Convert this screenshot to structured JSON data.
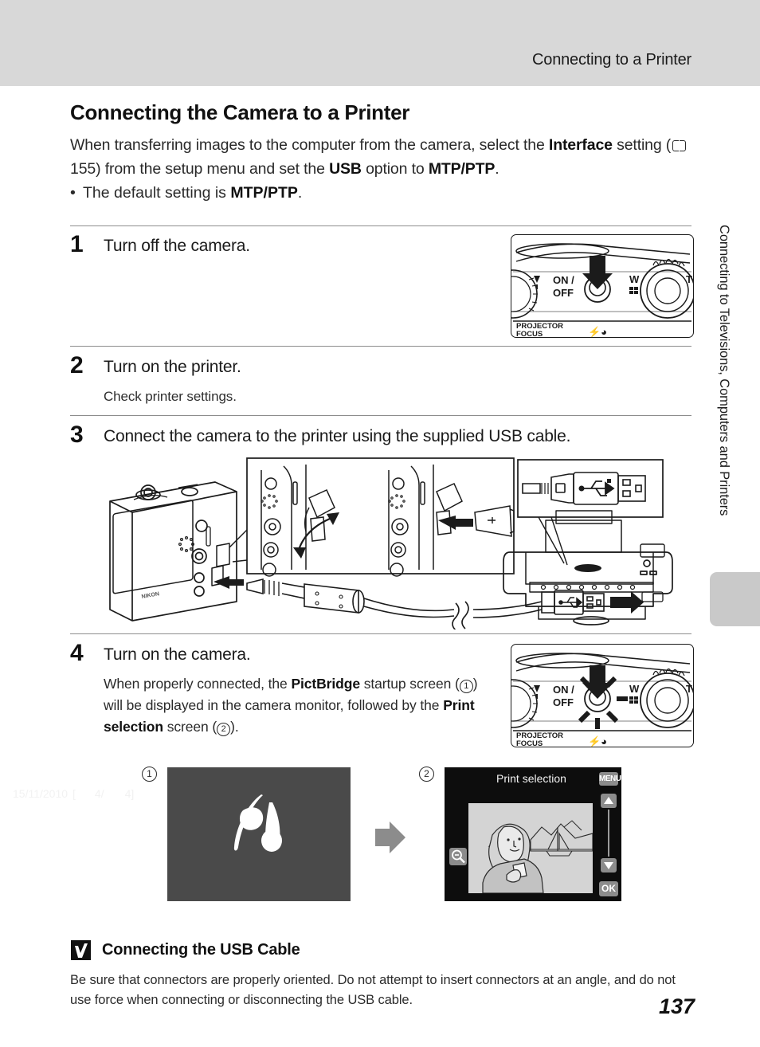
{
  "header": {
    "running_title": "Connecting to a Printer"
  },
  "side_tab": {
    "text": "Connecting to Televisions, Computers and Printers"
  },
  "section": {
    "heading": "Connecting the Camera to a Printer",
    "intro_part1": "When transferring images to the computer from the camera, select the ",
    "intro_bold1": "Interface",
    "intro_part2": " setting (",
    "intro_page_ref": "155",
    "intro_part3": ") from the setup menu and set the ",
    "intro_bold2": "USB",
    "intro_part4": " option to ",
    "intro_bold3": "MTP/PTP",
    "intro_part5": ".",
    "bullet_part1": "The default setting is ",
    "bullet_bold": "MTP/PTP",
    "bullet_part2": "."
  },
  "steps": [
    {
      "number": "1",
      "title": "Turn off the camera.",
      "sub": ""
    },
    {
      "number": "2",
      "title": "Turn on the printer.",
      "sub": "Check printer settings."
    },
    {
      "number": "3",
      "title": "Connect the camera to the printer using the supplied USB cable.",
      "sub": ""
    },
    {
      "number": "4",
      "title": "Turn on the camera.",
      "body_part1": "When properly connected, the ",
      "body_bold1": "PictBridge",
      "body_part2": " startup screen (",
      "body_circ1": "1",
      "body_part3": ") will be displayed in the camera monitor, followed by the ",
      "body_bold2": "Print selection",
      "body_part4": " screen (",
      "body_circ2": "2",
      "body_part5": ")."
    }
  ],
  "camera_illustration": {
    "on_off_label_top": "ON /",
    "on_off_label_bottom": "OFF",
    "wide_label": "W",
    "tele_label": "T",
    "projector_label": "PROJECTOR",
    "focus_label": "FOCUS",
    "flash_label": "4⟨"
  },
  "screens": {
    "marker1": "1",
    "marker2": "2",
    "pictbridge": {
      "wordmark": "PictBridge"
    },
    "print_selection": {
      "title": "Print selection",
      "date": "15/11/2010",
      "counter_open": "[",
      "counter_current": "4/",
      "counter_total": "4",
      "counter_close": "]",
      "menu_button": "MENU",
      "ok_button": "OK",
      "zoom_out_icon": "zoom-out-icon",
      "up_icon": "chevron-up-icon",
      "down_icon": "chevron-down-icon"
    }
  },
  "caution": {
    "title": "Connecting the USB Cable",
    "body": "Be sure that connectors are properly oriented. Do not attempt to insert connectors at an angle, and do not use force when connecting or disconnecting the USB cable."
  },
  "footer": {
    "page_number": "137"
  },
  "colors": {
    "header_band": "#d8d8d8",
    "side_tab_block": "#c9c9c9",
    "pictbridge_bg": "#4a4a4a",
    "print_screen_bg": "#0d0d0d",
    "rule": "#8d8d8d",
    "text": "#231f20"
  }
}
